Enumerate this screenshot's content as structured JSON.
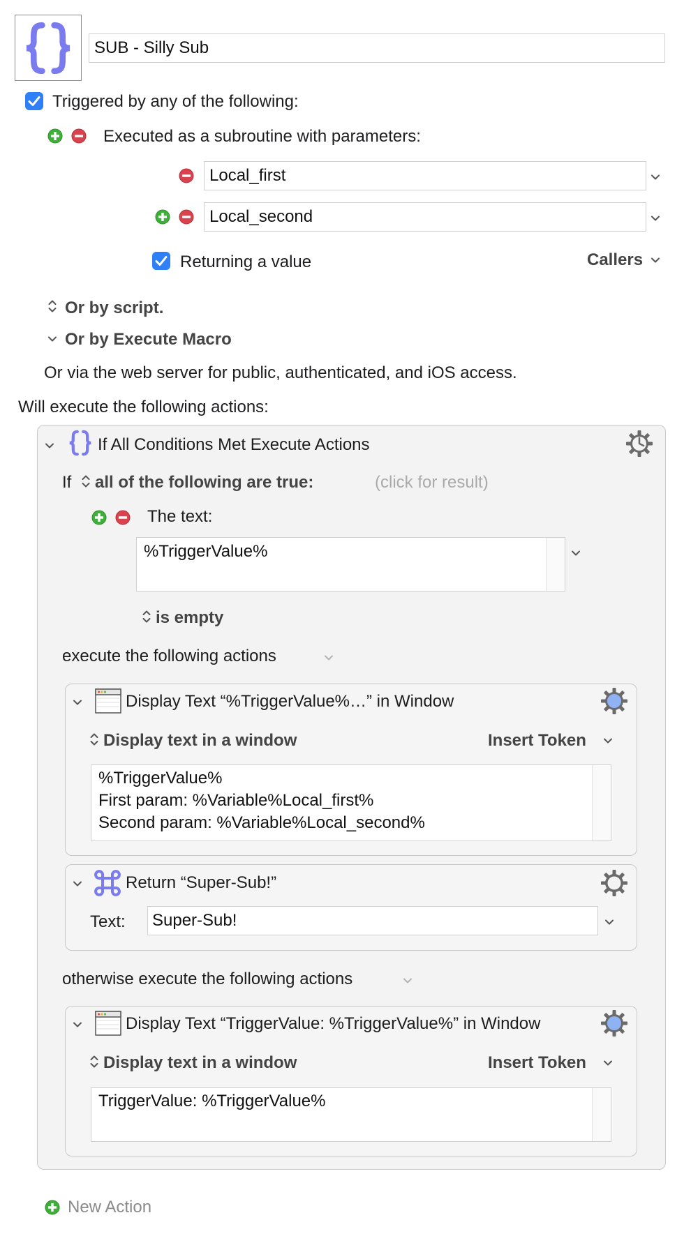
{
  "macro": {
    "name": "SUB - Silly Sub",
    "icon": "curly-braces-icon"
  },
  "triggers": {
    "header": "Triggered by any of the following:",
    "subroutine_label": "Executed as a subroutine with parameters:",
    "params": [
      "Local_first",
      "Local_second"
    ],
    "returning_label": "Returning a value",
    "callers_label": "Callers",
    "or_by_script": "Or by script.",
    "or_by_execute_macro": "Or by Execute Macro",
    "web_server": "Or via the web server for public, authenticated, and iOS access."
  },
  "actions_header": "Will execute the following actions:",
  "if_action": {
    "title": "If All Conditions Met Execute Actions",
    "if_prefix": "If",
    "condition_mode": "all of the following are true:",
    "click_for_result": "(click for result)",
    "the_text_label": "The text:",
    "text_value": "%TriggerValue%",
    "comparison": "is empty",
    "then_label": "execute the following actions",
    "else_label": "otherwise execute the following actions"
  },
  "then_actions": [
    {
      "title": "Display Text “%TriggerValue%…” in Window",
      "mode": "Display text in a window",
      "insert_token": "Insert Token",
      "line1": "%TriggerValue%",
      "line2": "First param: %Variable%Local_first%",
      "line3": "Second param: %Variable%Local_second%"
    },
    {
      "title": "Return “Super-Sub!”",
      "text_label": "Text:",
      "text_value": "Super-Sub!"
    }
  ],
  "else_actions": [
    {
      "title": "Display Text “TriggerValue: %TriggerValue%” in Window",
      "mode": "Display text in a window",
      "insert_token": "Insert Token",
      "line1": "TriggerValue: %TriggerValue%"
    }
  ],
  "new_action_label": "New Action",
  "colors": {
    "accent_blue": "#2f7ff6",
    "icon_purple": "#7b7bf0",
    "add_green": "#3fae3a",
    "remove_red": "#d9434e",
    "gear_blue": "#8fb2f5"
  }
}
